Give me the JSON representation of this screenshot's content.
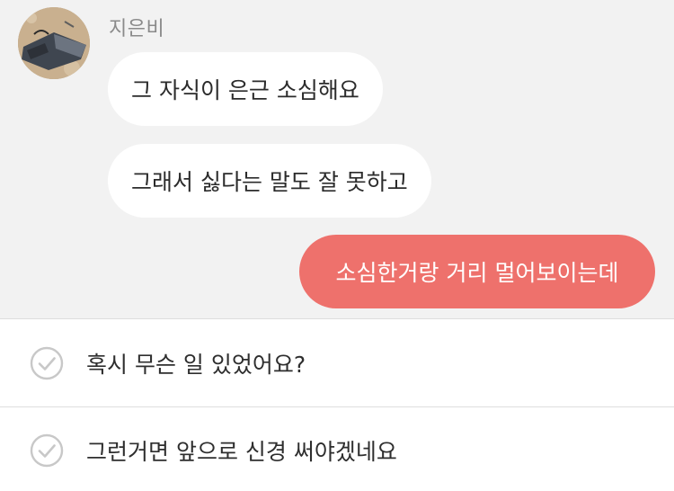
{
  "chat": {
    "sender_name": "지은비",
    "messages": [
      {
        "direction": "incoming",
        "text": "그 자식이 은근 소심해요"
      },
      {
        "direction": "incoming",
        "text": "그래서 싫다는 말도 잘 못하고"
      },
      {
        "direction": "outgoing",
        "text": "소심한거랑 거리 멀어보이는데"
      }
    ]
  },
  "replies": [
    {
      "text": "혹시 무슨 일 있었어요?",
      "icon": "check-circle-icon"
    },
    {
      "text": "그런거면 앞으로 신경 써야겠네요",
      "icon": "check-circle-icon"
    }
  ],
  "colors": {
    "chat_background": "#f2f2f2",
    "incoming_bubble": "#ffffff",
    "outgoing_bubble": "#ee716c",
    "check_icon": "#c8c8c8"
  }
}
